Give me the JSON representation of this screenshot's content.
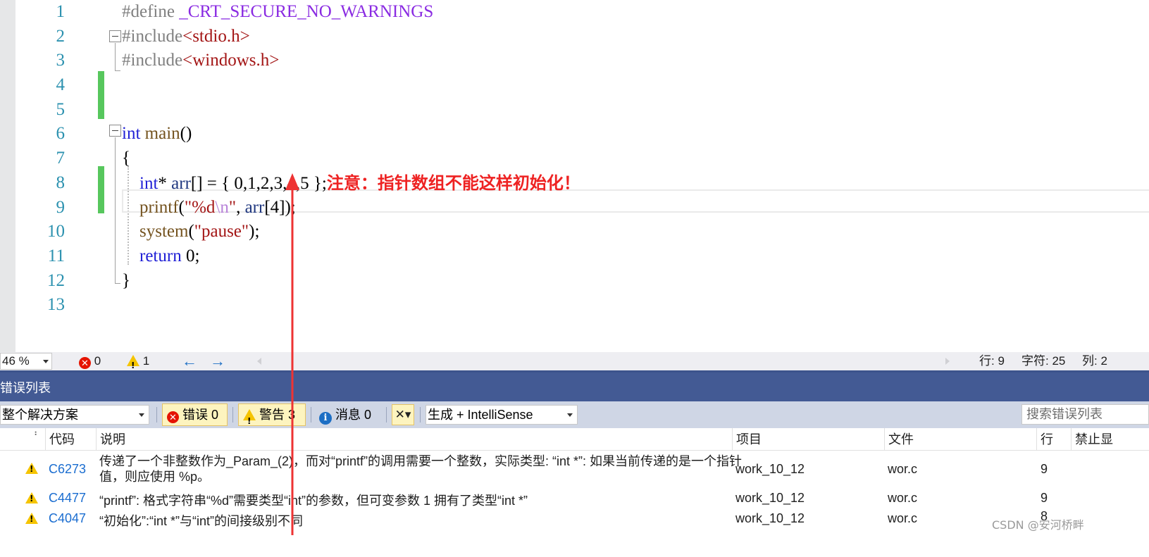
{
  "editor": {
    "line_numbers": [
      "1",
      "2",
      "3",
      "4",
      "5",
      "6",
      "7",
      "8",
      "9",
      "10",
      "11",
      "12",
      "13"
    ],
    "lines": [
      [
        {
          "t": "#define ",
          "c": "pp"
        },
        {
          "t": "_CRT_SECURE_NO_WARNINGS",
          "c": "mac"
        }
      ],
      [
        {
          "t": "#include",
          "c": "pp"
        },
        {
          "t": "<stdio.h>",
          "c": "str"
        }
      ],
      [
        {
          "t": "#include",
          "c": "pp"
        },
        {
          "t": "<windows.h>",
          "c": "str"
        }
      ],
      [],
      [],
      [
        {
          "t": "int",
          "c": "kw"
        },
        {
          "t": " ",
          "c": "plain"
        },
        {
          "t": "main",
          "c": "fn"
        },
        {
          "t": "()",
          "c": "plain"
        }
      ],
      [
        {
          "t": "{",
          "c": "plain"
        }
      ],
      [
        {
          "t": "    ",
          "c": "plain"
        },
        {
          "t": "int",
          "c": "kw"
        },
        {
          "t": "* ",
          "c": "plain"
        },
        {
          "t": "arr",
          "c": "var"
        },
        {
          "t": "[] = { 0,1,2,3,4,5 };",
          "c": "plain"
        },
        {
          "t": "注意：指针数组不能这样初始化！",
          "c": "annot"
        }
      ],
      [
        {
          "t": "    ",
          "c": "plain"
        },
        {
          "t": "printf",
          "c": "fn"
        },
        {
          "t": "(",
          "c": "plain"
        },
        {
          "t": "\"%d",
          "c": "str"
        },
        {
          "t": "\\n",
          "c": "esc"
        },
        {
          "t": "\"",
          "c": "str"
        },
        {
          "t": ", ",
          "c": "plain"
        },
        {
          "t": "arr",
          "c": "var"
        },
        {
          "t": "[4]);",
          "c": "plain"
        }
      ],
      [
        {
          "t": "    ",
          "c": "plain"
        },
        {
          "t": "system",
          "c": "fn"
        },
        {
          "t": "(",
          "c": "plain"
        },
        {
          "t": "\"pause\"",
          "c": "str"
        },
        {
          "t": ");",
          "c": "plain"
        }
      ],
      [
        {
          "t": "    ",
          "c": "plain"
        },
        {
          "t": "return",
          "c": "kw"
        },
        {
          "t": " 0;",
          "c": "plain"
        }
      ],
      [
        {
          "t": "}",
          "c": "plain"
        }
      ],
      []
    ]
  },
  "status_bar": {
    "zoom": "46 %",
    "error_count": "0",
    "warning_count": "1",
    "row": "行: 9",
    "char": "字符: 25",
    "col": "列: 2"
  },
  "error_list": {
    "title": "错误列表",
    "scope": "整个解决方案",
    "errors_btn": "错误 0",
    "warnings_btn": "警告 3",
    "messages_btn": "消息 0",
    "build_filter": "生成 + IntelliSense",
    "search_placeholder": "搜索错误列表",
    "columns": {
      "code": "代码",
      "desc": "说明",
      "project": "项目",
      "file": "文件",
      "line": "行",
      "suppress": "禁止显"
    },
    "rows": [
      {
        "code": "C6273",
        "desc1": "传递了一个非整数作为_Param_(2)，而对“printf”的调用需要一个整数，实际类型: “int *”: 如果当前传递的是一个指针",
        "desc2": "值，则应使用 %p。",
        "project": "work_10_12",
        "file": "wor.c",
        "line": "9"
      },
      {
        "code": "C4477",
        "desc1": "“printf”: 格式字符串“%d”需要类型“int”的参数，但可变参数 1 拥有了类型“int *”",
        "desc2": "",
        "project": "work_10_12",
        "file": "wor.c",
        "line": "9"
      },
      {
        "code": "C4047",
        "desc1": "“初始化”:“int *”与“int”的间接级别不同",
        "desc2": "",
        "project": "work_10_12",
        "file": "wor.c",
        "line": "8"
      }
    ]
  },
  "watermark": "CSDN @安河桥畔",
  "colors": {
    "accent_arrow": "#ee3333",
    "panel_title_bg": "#435a94",
    "change_bar": "#57c75d"
  },
  "icons": [
    "error-icon",
    "warning-icon",
    "info-icon",
    "arrow-left-icon",
    "arrow-right-icon",
    "filter-clear-icon",
    "fold-collapse-icon",
    "chevron-down-icon"
  ]
}
